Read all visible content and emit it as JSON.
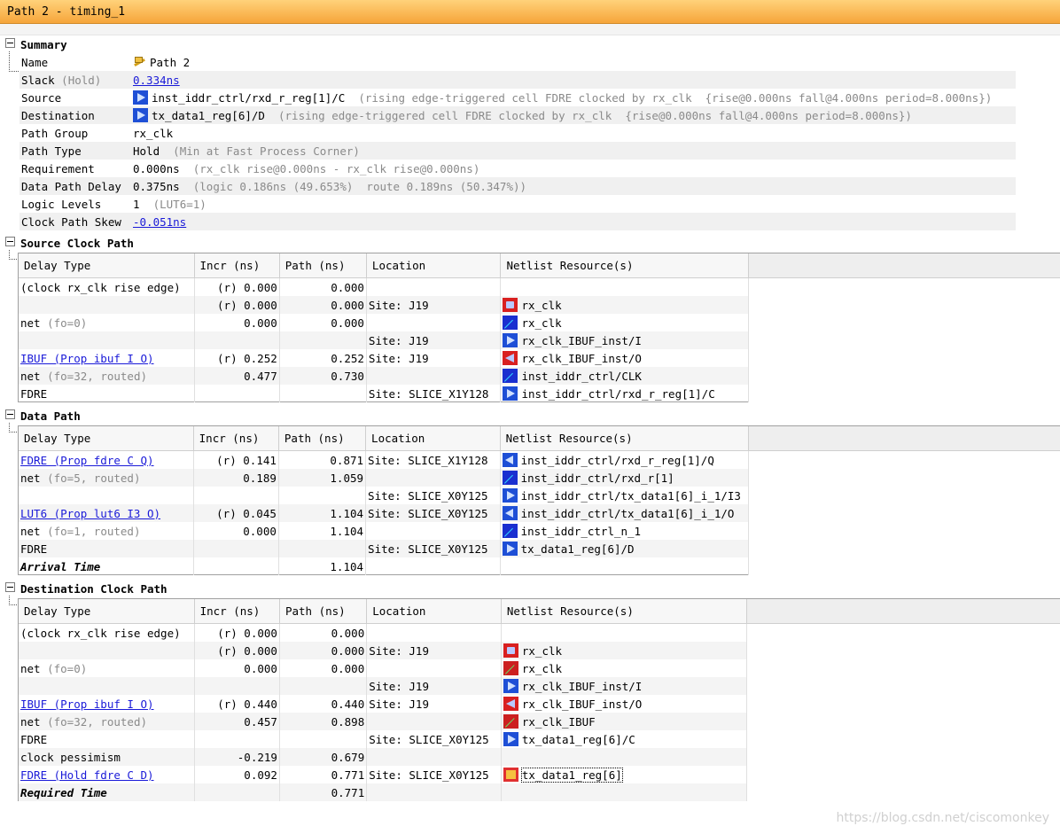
{
  "window": {
    "title": "Path 2 - timing_1"
  },
  "summary": {
    "header": "Summary",
    "rows": [
      {
        "key": "Name",
        "key_note": "",
        "value": "Path 2",
        "value_note": "",
        "icon": "path-icon",
        "link": false
      },
      {
        "key": "Slack",
        "key_note": "(Hold)",
        "value": "0.334ns",
        "value_note": "",
        "icon": "",
        "link": true
      },
      {
        "key": "Source",
        "key_note": "",
        "value": "inst_iddr_ctrl/rxd_r_reg[1]/C",
        "value_note": "(rising edge-triggered cell FDRE clocked by rx_clk  {rise@0.000ns fall@4.000ns period=8.000ns})",
        "icon": "pin-in-icon",
        "link": false
      },
      {
        "key": "Destination",
        "key_note": "",
        "value": "tx_data1_reg[6]/D",
        "value_note": "(rising edge-triggered cell FDRE clocked by rx_clk  {rise@0.000ns fall@4.000ns period=8.000ns})",
        "icon": "pin-in-icon",
        "link": false
      },
      {
        "key": "Path Group",
        "key_note": "",
        "value": "rx_clk",
        "value_note": "",
        "icon": "",
        "link": false
      },
      {
        "key": "Path Type",
        "key_note": "",
        "value": "Hold",
        "value_note": "(Min at Fast Process Corner)",
        "icon": "",
        "link": false
      },
      {
        "key": "Requirement",
        "key_note": "",
        "value": "0.000ns",
        "value_note": "(rx_clk rise@0.000ns - rx_clk rise@0.000ns)",
        "icon": "",
        "link": false
      },
      {
        "key": "Data Path Delay",
        "key_note": "",
        "value": "0.375ns",
        "value_note": "(logic 0.186ns (49.653%)  route 0.189ns (50.347%))",
        "icon": "",
        "link": false
      },
      {
        "key": "Logic Levels",
        "key_note": "",
        "value": "1",
        "value_note": "(LUT6=1)",
        "icon": "",
        "link": false
      },
      {
        "key": "Clock Path Skew",
        "key_note": "",
        "value": "-0.051ns",
        "value_note": "",
        "icon": "",
        "link": true
      }
    ]
  },
  "columns": [
    "Delay Type",
    "Incr (ns)",
    "Path (ns)",
    "Location",
    "Netlist Resource(s)"
  ],
  "sections": [
    {
      "header": "Source Clock Path",
      "rows": [
        {
          "type": "(clock rx_clk rise edge)",
          "type_note": "",
          "link": false,
          "incr": "(r) 0.000",
          "path": "0.000",
          "loc": "",
          "res": "",
          "icon": ""
        },
        {
          "type": "",
          "type_note": "",
          "link": false,
          "incr": "(r) 0.000",
          "path": "0.000",
          "loc": "Site: J19",
          "res": "rx_clk",
          "icon": "port-icon"
        },
        {
          "type": "net",
          "type_note": "(fo=0)",
          "link": false,
          "incr": "0.000",
          "path": "0.000",
          "loc": "",
          "res": "rx_clk",
          "icon": "net-icon"
        },
        {
          "type": "",
          "type_note": "",
          "link": false,
          "incr": "",
          "path": "",
          "loc": "Site: J19",
          "res": "rx_clk_IBUF_inst/I",
          "icon": "pin-in-icon"
        },
        {
          "type": "IBUF (Prop ibuf I O)",
          "type_note": "",
          "link": true,
          "incr": "(r) 0.252",
          "path": "0.252",
          "loc": "Site: J19",
          "res": "rx_clk_IBUF_inst/O",
          "icon": "port-out-icon"
        },
        {
          "type": "net",
          "type_note": "(fo=32, routed)",
          "link": false,
          "incr": "0.477",
          "path": "0.730",
          "loc": "",
          "res": "inst_iddr_ctrl/CLK",
          "icon": "net-icon"
        },
        {
          "type": "FDRE",
          "type_note": "",
          "link": false,
          "incr": "",
          "path": "",
          "loc": "Site: SLICE_X1Y128",
          "res": "inst_iddr_ctrl/rxd_r_reg[1]/C",
          "icon": "pin-in-icon"
        }
      ]
    },
    {
      "header": "Data Path",
      "rows": [
        {
          "type": "FDRE (Prop fdre C Q)",
          "type_note": "",
          "link": true,
          "incr": "(r) 0.141",
          "path": "0.871",
          "loc": "Site: SLICE_X1Y128",
          "res": "inst_iddr_ctrl/rxd_r_reg[1]/Q",
          "icon": "pin-out-icon"
        },
        {
          "type": "net",
          "type_note": "(fo=5, routed)",
          "link": false,
          "incr": "0.189",
          "path": "1.059",
          "loc": "",
          "res": "inst_iddr_ctrl/rxd_r[1]",
          "icon": "net-icon"
        },
        {
          "type": "",
          "type_note": "",
          "link": false,
          "incr": "",
          "path": "",
          "loc": "Site: SLICE_X0Y125",
          "res": "inst_iddr_ctrl/tx_data1[6]_i_1/I3",
          "icon": "pin-in-icon"
        },
        {
          "type": "LUT6 (Prop lut6 I3 O)",
          "type_note": "",
          "link": true,
          "incr": "(r) 0.045",
          "path": "1.104",
          "loc": "Site: SLICE_X0Y125",
          "res": "inst_iddr_ctrl/tx_data1[6]_i_1/O",
          "icon": "pin-out-icon"
        },
        {
          "type": "net",
          "type_note": "(fo=1, routed)",
          "link": false,
          "incr": "0.000",
          "path": "1.104",
          "loc": "",
          "res": "inst_iddr_ctrl_n_1",
          "icon": "net-icon"
        },
        {
          "type": "FDRE",
          "type_note": "",
          "link": false,
          "incr": "",
          "path": "",
          "loc": "Site: SLICE_X0Y125",
          "res": "tx_data1_reg[6]/D",
          "icon": "pin-in-icon"
        },
        {
          "type": "Arrival Time",
          "type_note": "",
          "link": false,
          "bold": true,
          "incr": "",
          "path": "1.104",
          "loc": "",
          "res": "",
          "icon": ""
        }
      ]
    },
    {
      "header": "Destination Clock Path",
      "rows": [
        {
          "type": "(clock rx_clk rise edge)",
          "type_note": "",
          "link": false,
          "incr": "(r) 0.000",
          "path": "0.000",
          "loc": "",
          "res": "",
          "icon": ""
        },
        {
          "type": "",
          "type_note": "",
          "link": false,
          "incr": "(r) 0.000",
          "path": "0.000",
          "loc": "Site: J19",
          "res": "rx_clk",
          "icon": "port-icon"
        },
        {
          "type": "net",
          "type_note": "(fo=0)",
          "link": false,
          "incr": "0.000",
          "path": "0.000",
          "loc": "",
          "res": "rx_clk",
          "icon": "net-red-icon"
        },
        {
          "type": "",
          "type_note": "",
          "link": false,
          "incr": "",
          "path": "",
          "loc": "Site: J19",
          "res": "rx_clk_IBUF_inst/I",
          "icon": "pin-in-icon"
        },
        {
          "type": "IBUF (Prop ibuf I O)",
          "type_note": "",
          "link": true,
          "incr": "(r) 0.440",
          "path": "0.440",
          "loc": "Site: J19",
          "res": "rx_clk_IBUF_inst/O",
          "icon": "port-out-icon"
        },
        {
          "type": "net",
          "type_note": "(fo=32, routed)",
          "link": false,
          "incr": "0.457",
          "path": "0.898",
          "loc": "",
          "res": "rx_clk_IBUF",
          "icon": "net-red-icon"
        },
        {
          "type": "FDRE",
          "type_note": "",
          "link": false,
          "incr": "",
          "path": "",
          "loc": "Site: SLICE_X0Y125",
          "res": "tx_data1_reg[6]/C",
          "icon": "pin-in-icon"
        },
        {
          "type": "clock pessimism",
          "type_note": "",
          "link": false,
          "incr": "-0.219",
          "path": "0.679",
          "loc": "",
          "res": "",
          "icon": ""
        },
        {
          "type": "FDRE (Hold fdre C D)",
          "type_note": "",
          "link": true,
          "incr": "0.092",
          "path": "0.771",
          "loc": "Site: SLICE_X0Y125",
          "res": "tx_data1_reg[6]",
          "icon": "cell-icon",
          "selected": true
        },
        {
          "type": "Required Time",
          "type_note": "",
          "link": false,
          "bold": true,
          "incr": "",
          "path": "0.771",
          "loc": "",
          "res": "",
          "icon": ""
        }
      ]
    }
  ],
  "watermark": "https://blog.csdn.net/ciscomonkey"
}
